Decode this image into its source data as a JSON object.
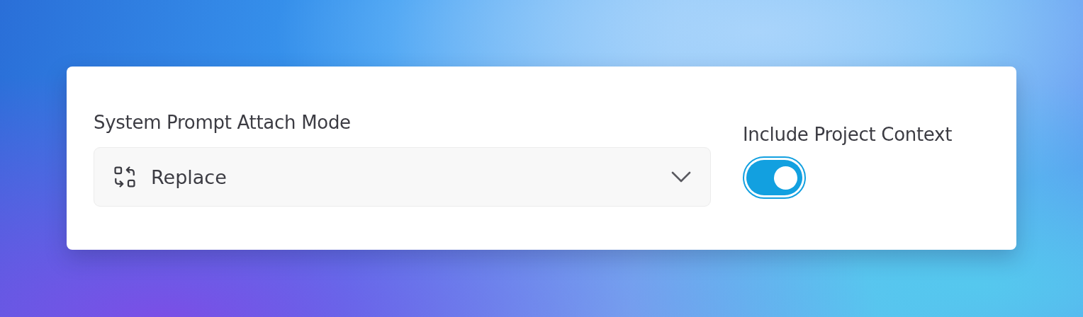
{
  "attach_mode": {
    "label": "System Prompt Attach Mode",
    "value": "Replace"
  },
  "project_context": {
    "label": "Include Project Context",
    "on": true
  }
}
